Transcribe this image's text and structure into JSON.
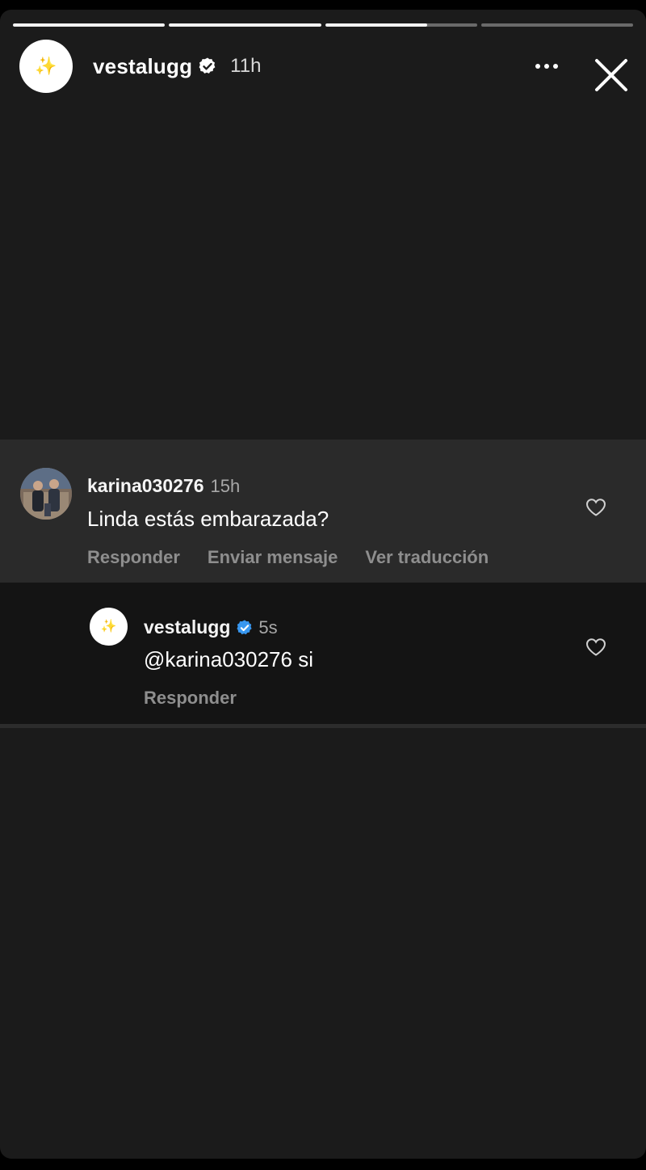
{
  "story": {
    "progress": [
      1.0,
      1.0,
      0.67,
      0.0
    ],
    "username": "vestalugg",
    "time": "11h",
    "avatar_icon": "sparkle-icon"
  },
  "comment": {
    "username": "karina030276",
    "time": "15h",
    "text": "Linda estás embarazada?",
    "actions": {
      "reply": "Responder",
      "send_message": "Enviar mensaje",
      "translate": "Ver traducción"
    }
  },
  "reply": {
    "username": "vestalugg",
    "time": "5s",
    "text": "@karina030276 si",
    "actions": {
      "reply": "Responder"
    }
  },
  "colors": {
    "background": "#1b1b1b",
    "comment_bg": "#2a2a2a",
    "reply_bg": "#141414",
    "verified_blue": "#3897f0",
    "muted_text": "#8e8e8e"
  }
}
